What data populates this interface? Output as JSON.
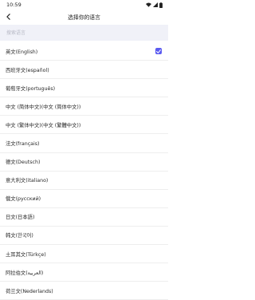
{
  "status_bar": {
    "time": "10:59"
  },
  "header": {
    "title": "选择你的语言"
  },
  "search": {
    "placeholder": "搜索语言"
  },
  "languages": [
    {
      "label": "英文(English)",
      "selected": true
    },
    {
      "label": "西班牙文(español)",
      "selected": false
    },
    {
      "label": "葡萄牙文(português)",
      "selected": false
    },
    {
      "label": "中文 (简体中文)(中文 (简体中文))",
      "selected": false
    },
    {
      "label": "中文 (繁体中文)(中文 (繁體中文))",
      "selected": false
    },
    {
      "label": "法文(français)",
      "selected": false
    },
    {
      "label": "德文(Deutsch)",
      "selected": false
    },
    {
      "label": "意大利文(italiano)",
      "selected": false
    },
    {
      "label": "俄文(русский)",
      "selected": false
    },
    {
      "label": "日文(日本語)",
      "selected": false
    },
    {
      "label": "韩文(한국어)",
      "selected": false
    },
    {
      "label": "土耳其文(Türkçe)",
      "selected": false
    },
    {
      "label": "阿拉伯文(العربية)",
      "selected": false
    },
    {
      "label": "荷兰文(Nederlands)",
      "selected": false
    }
  ],
  "colors": {
    "accent": "#5b5bf0",
    "search_bg": "#f0f1f8"
  },
  "icons": {
    "back": "back-arrow-icon",
    "check": "checkmark-icon",
    "wifi": "wifi-icon",
    "signal": "signal-icon",
    "battery": "battery-icon"
  }
}
